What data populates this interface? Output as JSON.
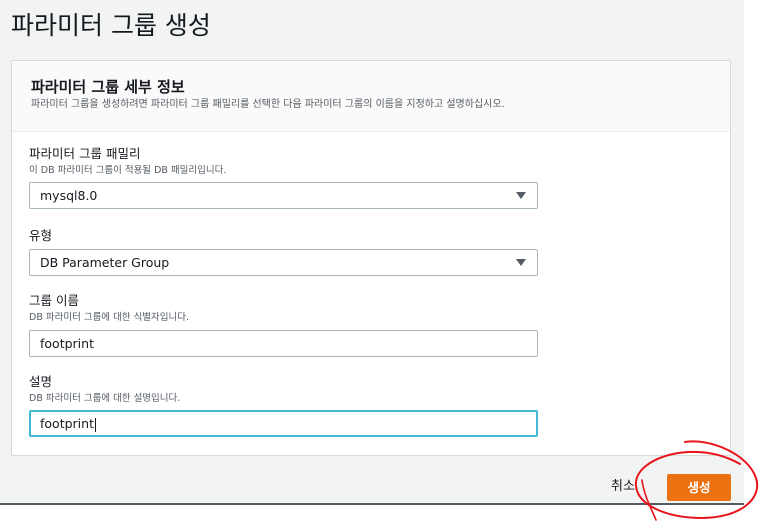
{
  "page": {
    "title": "파라미터 그룹 생성"
  },
  "panel": {
    "title": "파라미터 그룹 세부 정보",
    "description": "파라미터 그룹을 생성하려면 파라미터 그룹 패밀리를 선택한 다음 파라미터 그룹의 이름을 지정하고 설명하십시오."
  },
  "fields": {
    "family": {
      "label": "파라미터 그룹 패밀리",
      "hint": "이 DB 파라미터 그룹이 적용될 DB 패밀리입니다.",
      "value": "mysql8.0"
    },
    "type": {
      "label": "유형",
      "value": "DB Parameter Group"
    },
    "group_name": {
      "label": "그룹 이름",
      "hint": "DB 파라미터 그룹에 대한 식별자입니다.",
      "value": "footprint"
    },
    "description": {
      "label": "설명",
      "hint": "DB 파라미터 그룹에 대한 설명입니다.",
      "value": "footprint"
    }
  },
  "actions": {
    "cancel_label": "취소",
    "create_label": "생성"
  },
  "colors": {
    "primary_button": "#ec7211",
    "focus_border": "#44b9d6",
    "annotation_circle": "#e8141c"
  }
}
